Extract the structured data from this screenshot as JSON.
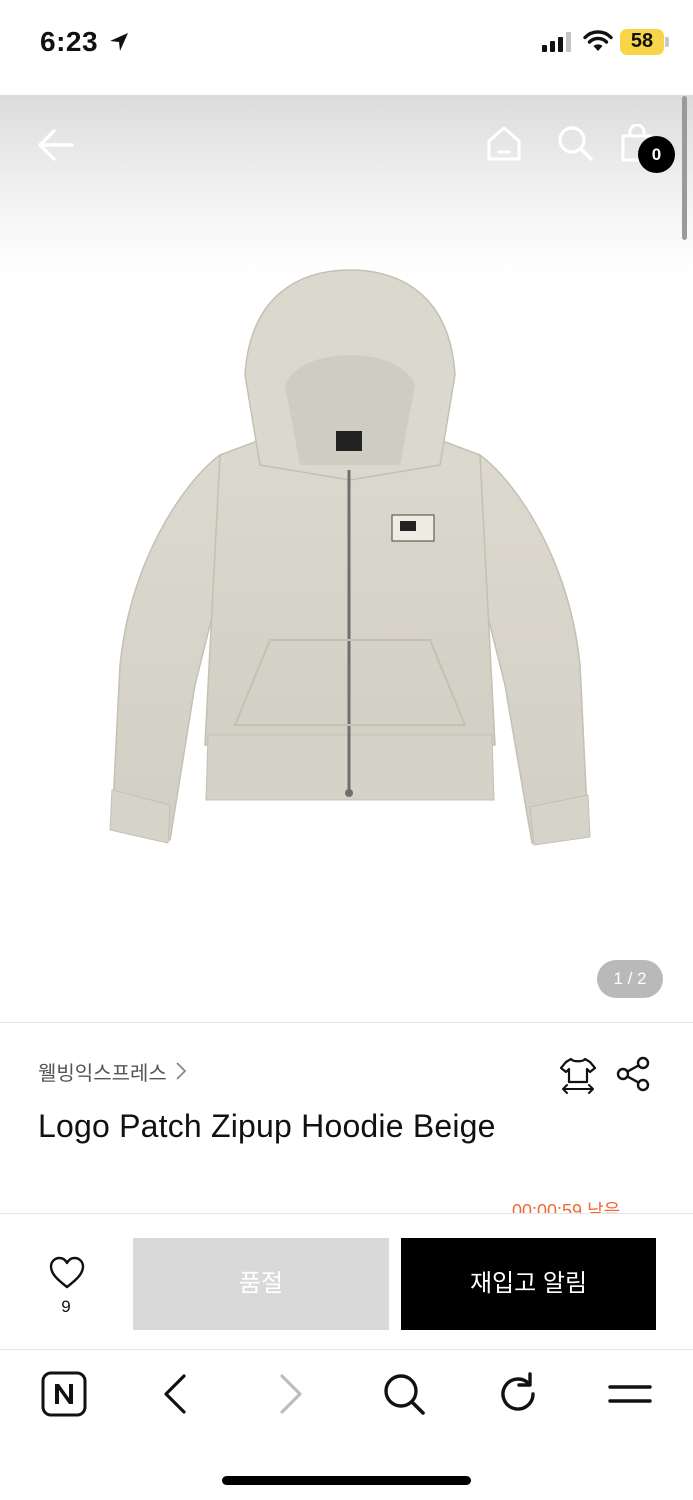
{
  "status_bar": {
    "time": "6:23",
    "battery_level": "58",
    "battery_color": "#f6d648",
    "icons": [
      "location-arrow-icon",
      "cellular-signal-icon",
      "wifi-icon",
      "battery-icon"
    ]
  },
  "header": {
    "icons": [
      "back-arrow-icon",
      "home-icon",
      "search-icon",
      "shopping-bag-icon"
    ],
    "cart_count": "0"
  },
  "gallery": {
    "page_indicator": "1 / 2",
    "image_subject": "beige zip-up hoodie with logo patch"
  },
  "product": {
    "brand": "웰빙익스프레스",
    "title": "Logo Patch Zipup Hoodie Beige",
    "countdown_partial": "00:00:59 남음",
    "countdown_color": "#ee6a3a",
    "action_icons": [
      "size-guide-icon",
      "share-icon"
    ]
  },
  "actions": {
    "like_count": "9",
    "sold_out_label": "품절",
    "restock_label": "재입고 알림"
  },
  "browser_toolbar": {
    "icons": [
      "naver-n-icon",
      "back-chevron-icon",
      "forward-chevron-icon",
      "search-icon",
      "refresh-icon",
      "menu-icon"
    ]
  }
}
